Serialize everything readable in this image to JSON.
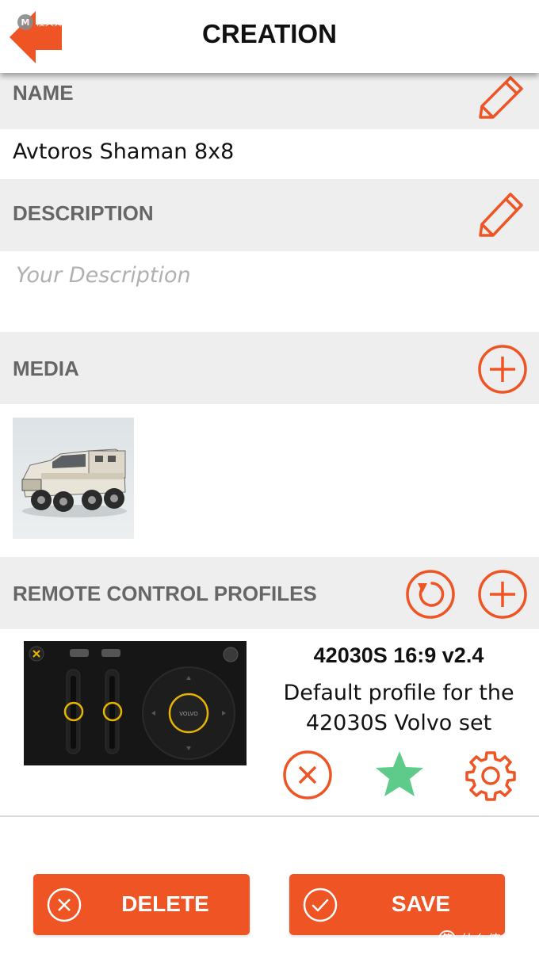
{
  "header": {
    "title": "CREATION",
    "watermark_logo": "M",
    "watermark_text": "漫天舞动漫"
  },
  "name_section": {
    "label": "NAME",
    "value": "Avtoros Shaman 8x8",
    "edit_icon": "pencil-icon"
  },
  "description_section": {
    "label": "DESCRIPTION",
    "placeholder": "Your Description",
    "edit_icon": "pencil-icon"
  },
  "media_section": {
    "label": "MEDIA",
    "add_icon": "plus-circle-icon"
  },
  "profiles_section": {
    "label": "REMOTE CONTROL PROFILES",
    "refresh_icon": "refresh-icon",
    "add_icon": "plus-circle-icon",
    "profile": {
      "name": "42030S 16:9 v2.4",
      "description": "Default profile for the 42030S Volvo set",
      "joystick_label": "VOLVO",
      "actions": [
        "delete-circle-icon",
        "star-icon",
        "gear-icon"
      ]
    }
  },
  "footer": {
    "delete_label": "DELETE",
    "save_label": "SAVE"
  },
  "watermark_bottom": {
    "icon": "值",
    "text": "什么值得买"
  },
  "colors": {
    "accent": "#ee5424",
    "section_bg": "#eeeeee",
    "star": "#5ecb8b",
    "label_gray": "#666666"
  }
}
